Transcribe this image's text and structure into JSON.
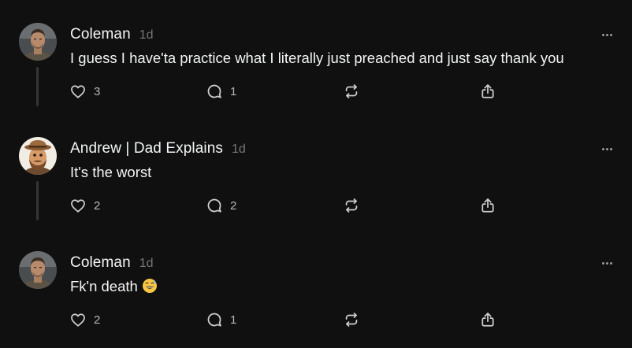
{
  "posts": [
    {
      "username": "Coleman",
      "time": "1d",
      "text": "I guess I have'ta practice what I literally just preached and just say thank you",
      "emoji": "",
      "avatar": "man-portrait",
      "likes": "3",
      "replies": "1",
      "has_thread_line": true
    },
    {
      "username": "Andrew | Dad Explains",
      "time": "1d",
      "text": "It's the worst",
      "emoji": "",
      "avatar": "cartoon-man-hat",
      "likes": "2",
      "replies": "2",
      "has_thread_line": true
    },
    {
      "username": "Coleman",
      "time": "1d",
      "text": "Fk'n death",
      "emoji": "grinning-sweat-emoji",
      "avatar": "man-portrait",
      "likes": "2",
      "replies": "1",
      "has_thread_line": false
    }
  ],
  "icons": {
    "like": "heart-icon",
    "reply": "comment-icon",
    "repost": "repost-icon",
    "share": "share-icon",
    "more": "more-icon"
  },
  "colors": {
    "background": "#101010",
    "text": "#f3f5f7",
    "muted": "#777777",
    "icon": "#cfcfcf",
    "thread_line": "#333638"
  }
}
